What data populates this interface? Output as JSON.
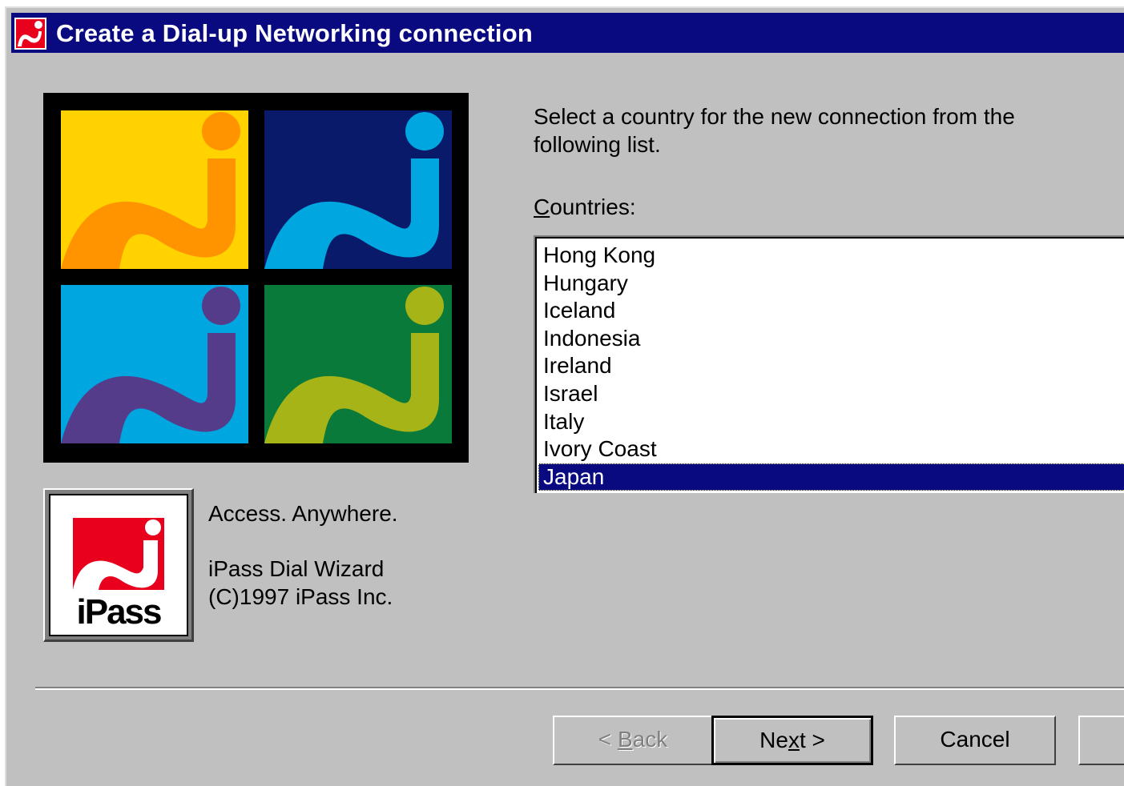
{
  "window": {
    "title": "Create a Dial-up Networking connection"
  },
  "wizard": {
    "instruction": "Select a country for the new connection from the following list.",
    "countries_label_accel": "C",
    "countries_label_rest": "ountries:"
  },
  "countries": {
    "items": [
      "Hong Kong",
      "Hungary",
      "Iceland",
      "Indonesia",
      "Ireland",
      "Israel",
      "Italy",
      "Ivory Coast",
      "Japan"
    ],
    "selected": "Japan"
  },
  "branding": {
    "tagline": "Access. Anywhere.",
    "product": "iPass Dial Wizard",
    "copyright": "(C)1997 iPass Inc.",
    "logo_text": "iPass"
  },
  "buttons": {
    "back_pre": "< ",
    "back_accel": "B",
    "back_post": "ack",
    "next_pre": "Ne",
    "next_accel": "x",
    "next_post": "t >",
    "cancel": "Cancel",
    "help": ""
  },
  "colors": {
    "title_bar": "#0a0a80",
    "face": "#c0c0c0",
    "selection": "#0a0a80"
  }
}
